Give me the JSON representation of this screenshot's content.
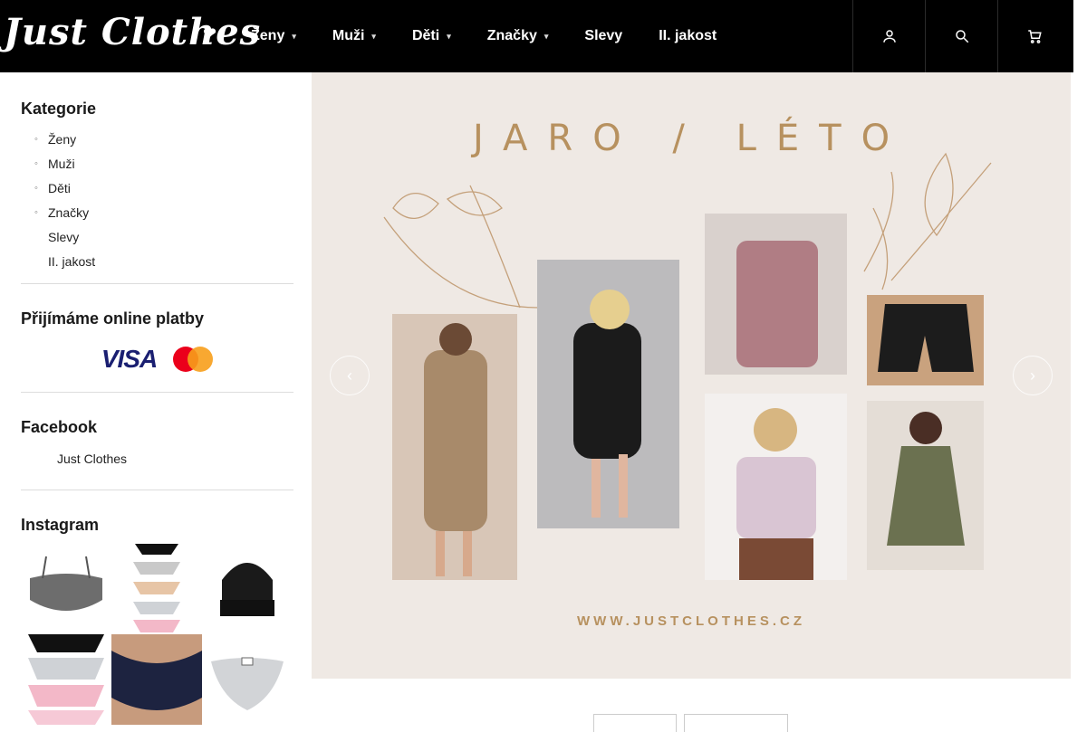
{
  "brand": {
    "logo_text": "Just Clothes"
  },
  "nav": {
    "items": [
      {
        "label": "Ženy",
        "has_dropdown": true
      },
      {
        "label": "Muži",
        "has_dropdown": true
      },
      {
        "label": "Děti",
        "has_dropdown": true
      },
      {
        "label": "Značky",
        "has_dropdown": true
      },
      {
        "label": "Slevy",
        "has_dropdown": false
      },
      {
        "label": "II. jakost",
        "has_dropdown": false
      }
    ],
    "icons": [
      "user-icon",
      "search-icon",
      "cart-icon"
    ]
  },
  "sidebar": {
    "categories_heading": "Kategorie",
    "categories": [
      "Ženy",
      "Muži",
      "Děti",
      "Značky",
      "Slevy",
      "II. jakost"
    ],
    "payments_heading": "Přijímáme online platby",
    "payment_logos": {
      "visa": "VISA",
      "mastercard": "mastercard"
    },
    "facebook_heading": "Facebook",
    "facebook_link": "Just Clothes",
    "instagram_heading": "Instagram"
  },
  "banner": {
    "title": "JARO / LÉTO",
    "url": "WWW.JUSTCLOTHES.CZ",
    "accent_color": "#b7915f",
    "background_color": "#efe9e4"
  },
  "colors": {
    "nav_background": "#000000",
    "text_dark": "#1a1a1a"
  }
}
